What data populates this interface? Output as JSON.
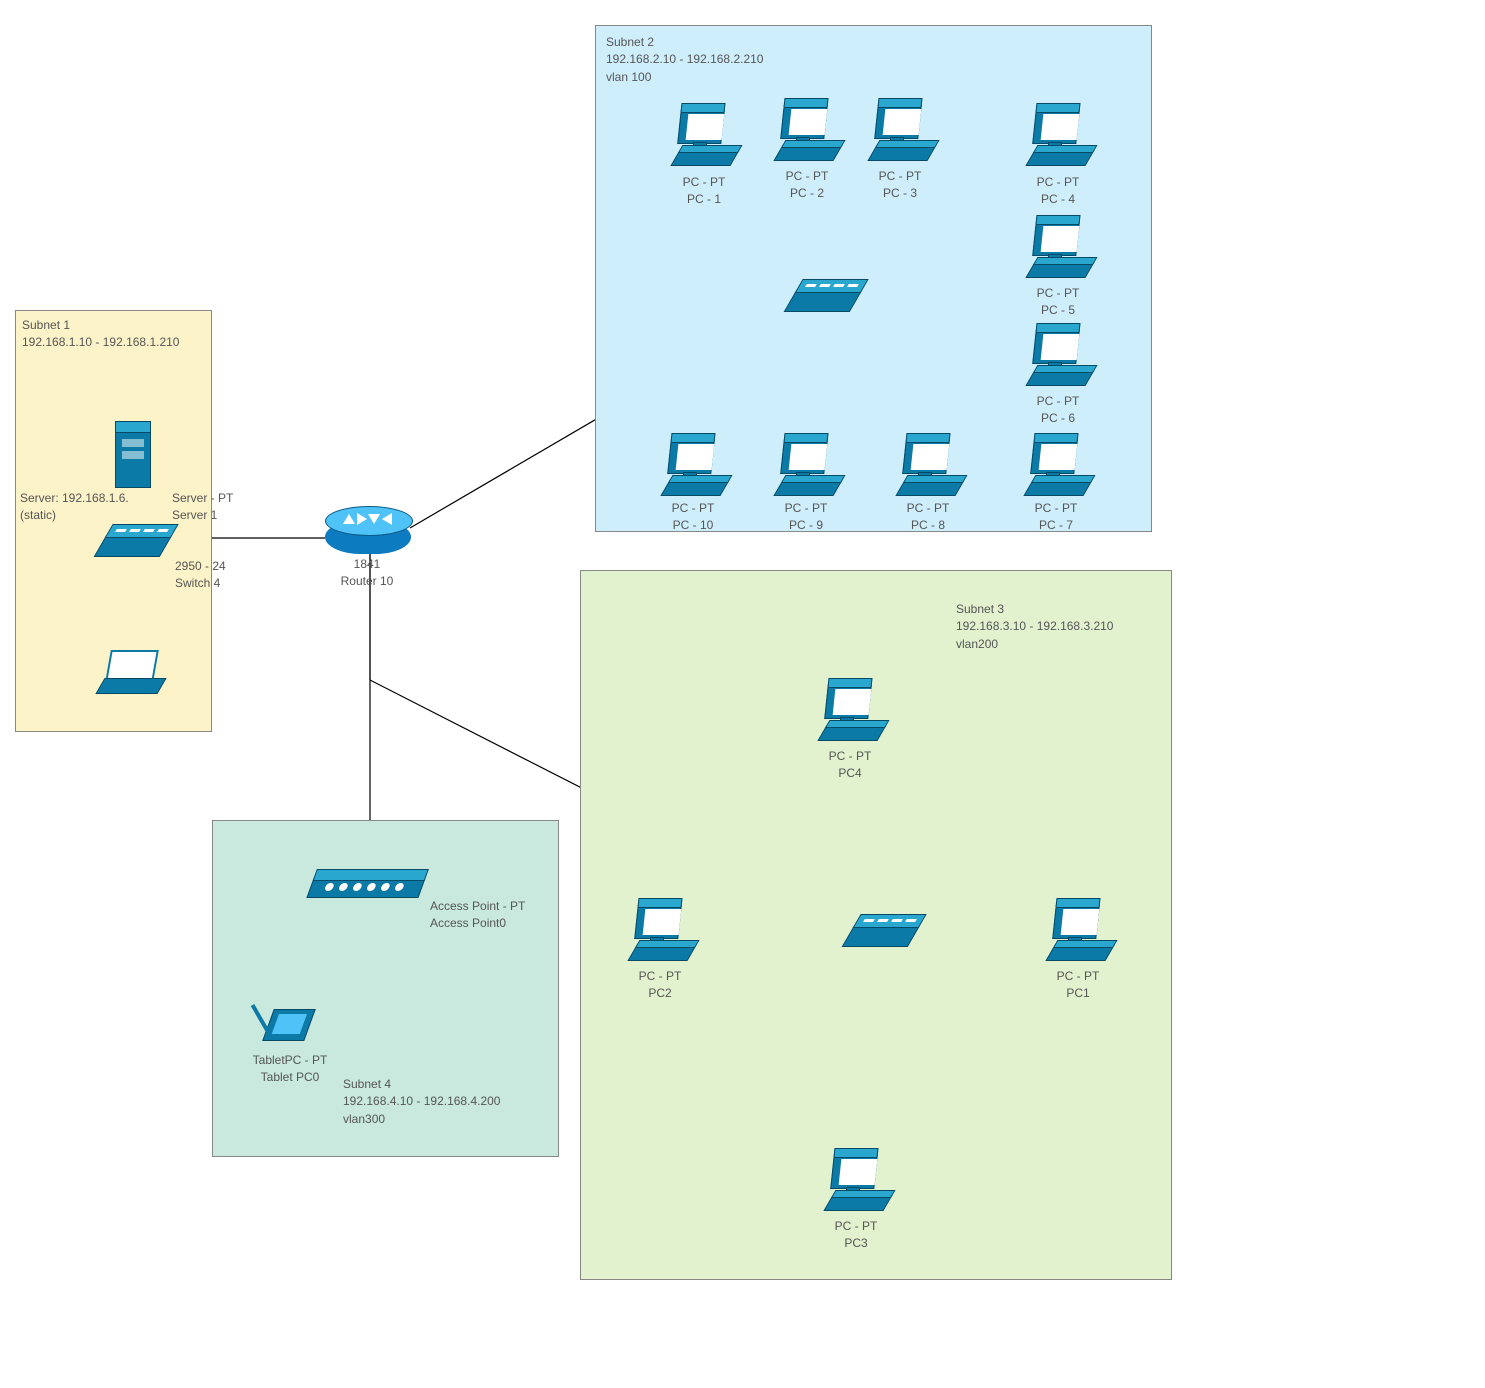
{
  "router": {
    "type": "1841",
    "name": "Router 10"
  },
  "subnet1": {
    "title": "Subnet 1",
    "range": "192.168.1.10 - 192.168.1.210",
    "server_ip_label": "Server: 192.168.1.6.",
    "server_ip_static": "(static)",
    "server": {
      "type": "Server - PT",
      "name": "Server 1"
    },
    "switch": {
      "type": "2950 - 24",
      "name": "Switch 4"
    },
    "laptop": {
      "type": "",
      "name": ""
    }
  },
  "subnet2": {
    "title": "Subnet 2",
    "range": "192.168.2.10 - 192.168.2.210",
    "vlan": "vlan 100",
    "pcs": [
      {
        "type": "PC - PT",
        "name": "PC - 1"
      },
      {
        "type": "PC - PT",
        "name": "PC - 2"
      },
      {
        "type": "PC - PT",
        "name": "PC - 3"
      },
      {
        "type": "PC - PT",
        "name": "PC - 4"
      },
      {
        "type": "PC - PT",
        "name": "PC - 5"
      },
      {
        "type": "PC - PT",
        "name": "PC - 6"
      },
      {
        "type": "PC - PT",
        "name": "PC - 7"
      },
      {
        "type": "PC - PT",
        "name": "PC - 8"
      },
      {
        "type": "PC - PT",
        "name": "PC - 9"
      },
      {
        "type": "PC - PT",
        "name": "PC - 10"
      }
    ]
  },
  "subnet3": {
    "title": "Subnet 3",
    "range": "192.168.3.10 - 192.168.3.210",
    "vlan": "vlan200",
    "pcs": [
      {
        "type": "PC - PT",
        "name": "PC1"
      },
      {
        "type": "PC - PT",
        "name": "PC2"
      },
      {
        "type": "PC - PT",
        "name": "PC3"
      },
      {
        "type": "PC - PT",
        "name": "PC4"
      }
    ]
  },
  "subnet4": {
    "title": "Subnet 4",
    "range": "192.168.4.10 - 192.168.4.200",
    "vlan": "vlan300",
    "ap": {
      "type": "Access Point - PT",
      "name": "Access Point0"
    },
    "tablet": {
      "type": "TabletPC - PT",
      "name": "Tablet PC0"
    }
  }
}
